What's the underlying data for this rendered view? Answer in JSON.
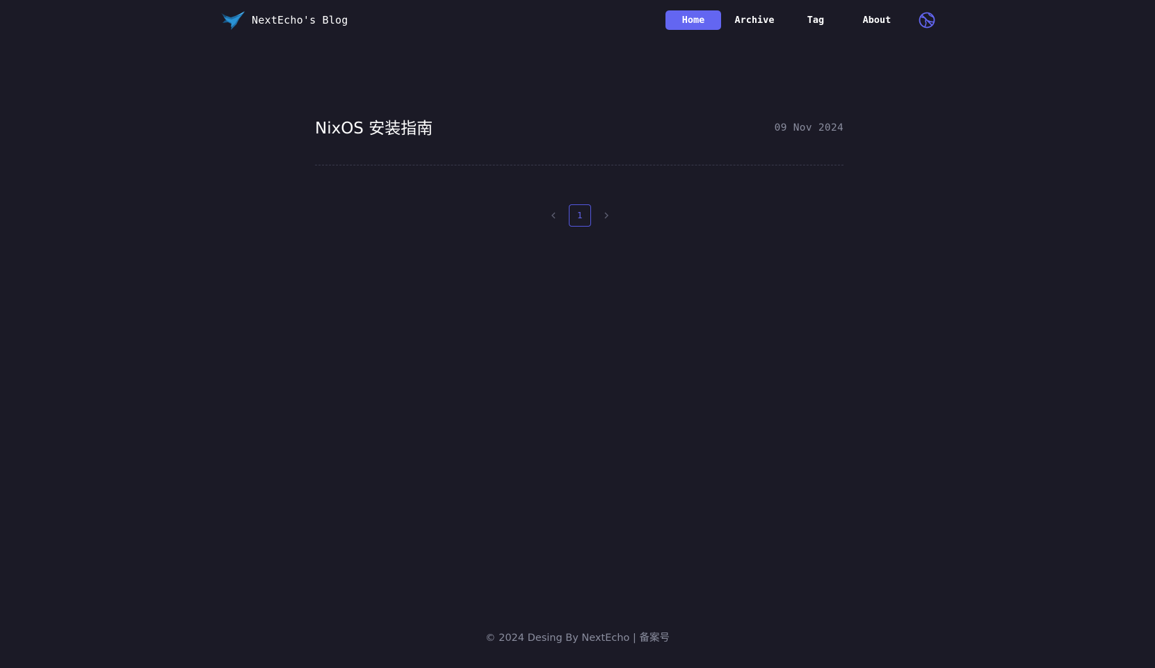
{
  "header": {
    "brand_title": "NextEcho's Blog",
    "logo_icon": "bird-logo-icon",
    "nav": {
      "home": "Home",
      "archive": "Archive",
      "tag": "Tag",
      "about": "About"
    },
    "active_nav": "home",
    "language_icon": "globe-translate-icon"
  },
  "posts": [
    {
      "title": "NixOS 安装指南",
      "date": "09 Nov 2024"
    }
  ],
  "pagination": {
    "prev_icon": "chevron-left-icon",
    "current_page": "1",
    "next_icon": "chevron-right-icon"
  },
  "footer": {
    "copyright": "© 2024 Desing By NextEcho | ",
    "beian": "备案号"
  },
  "colors": {
    "background": "#1b1a26",
    "accent": "#6366f1",
    "text_primary": "#ffffff",
    "text_muted": "#8a8d9e"
  }
}
